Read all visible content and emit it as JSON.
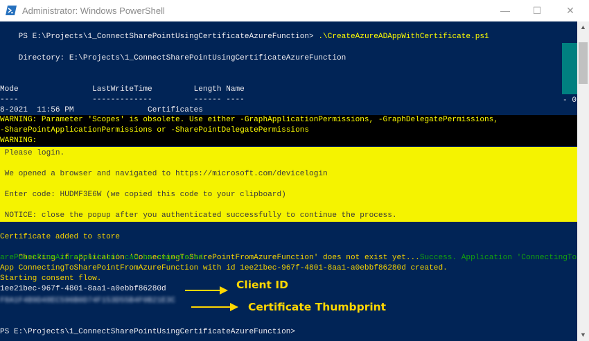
{
  "window": {
    "title": "Administrator: Windows PowerShell",
    "icon": "powershell-icon",
    "controls": {
      "minimize": "—",
      "maximize": "☐",
      "close": "✕"
    }
  },
  "console": {
    "lines": [
      {
        "text": "PS E:\\Projects\\1_ConnectSharePointUsingCertificateAzureFunction> "
      },
      {
        "text": "    Directory: E:\\Projects\\1_ConnectSharePointUsingCertificateAzureFunction"
      },
      {
        "text": "Mode                LastWriteTime         Length Name"
      },
      {
        "text": "----                -------------         ------ ----"
      },
      {
        "text": "8-2021  11:56 PM                Certificates"
      }
    ],
    "command": ".\\CreateAzureADAppWithCertificate.ps1",
    "right_edge_fragment": "- 0",
    "warnings": [
      "WARNING: Parameter 'Scopes' is obsolete. Use either -GraphApplicationPermissions, -GraphDelegatePermissions,",
      "-SharePointApplicationPermissions or -SharePointDelegatePermissions",
      "WARNING:"
    ],
    "login": [
      " Please login.",
      " We opened a browser and navigated to https://microsoft.com/devicelogin",
      " Enter code: HUDMF3E6W (we copied this code to your clipboard)",
      " NOTICE: close the popup after you authenticated successfully to continue the process."
    ],
    "output": {
      "cert_added": "Certificate added to store",
      "checking_prefix": "Checking if application 'ConnectingToSharePointFromAzureFunction' does not exist yet...",
      "success_text": "Success. Application 'ConnectingToSh",
      "registered": "arePointFromAzureFunction' can be registered.",
      "created": "App ConnectingToSharePointFromAzureFunction with id 1ee21bec-967f-4801-8aa1-a0ebbf86280d created.",
      "consent": "Starting consent flow.",
      "client_id": "1ee21bec-967f-4801-8aa1-a0ebbf86280d",
      "thumbprint_blurred": "F8A1F4B9D48EC596B0D74F153D55B4F0B21E3C",
      "final_prompt": "PS E:\\Projects\\1_ConnectSharePointUsingCertificateAzureFunction>"
    }
  },
  "annotations": {
    "client_id_label": "Client ID",
    "thumbprint_label": "Certificate Thumbprint"
  },
  "colors": {
    "console_bg": "#012456",
    "warning_bg": "#000000",
    "login_bg": "#f5f300",
    "accent_yellow": "#ffff00",
    "success_green": "#13a10e",
    "annotation_gold": "#ffd700"
  }
}
